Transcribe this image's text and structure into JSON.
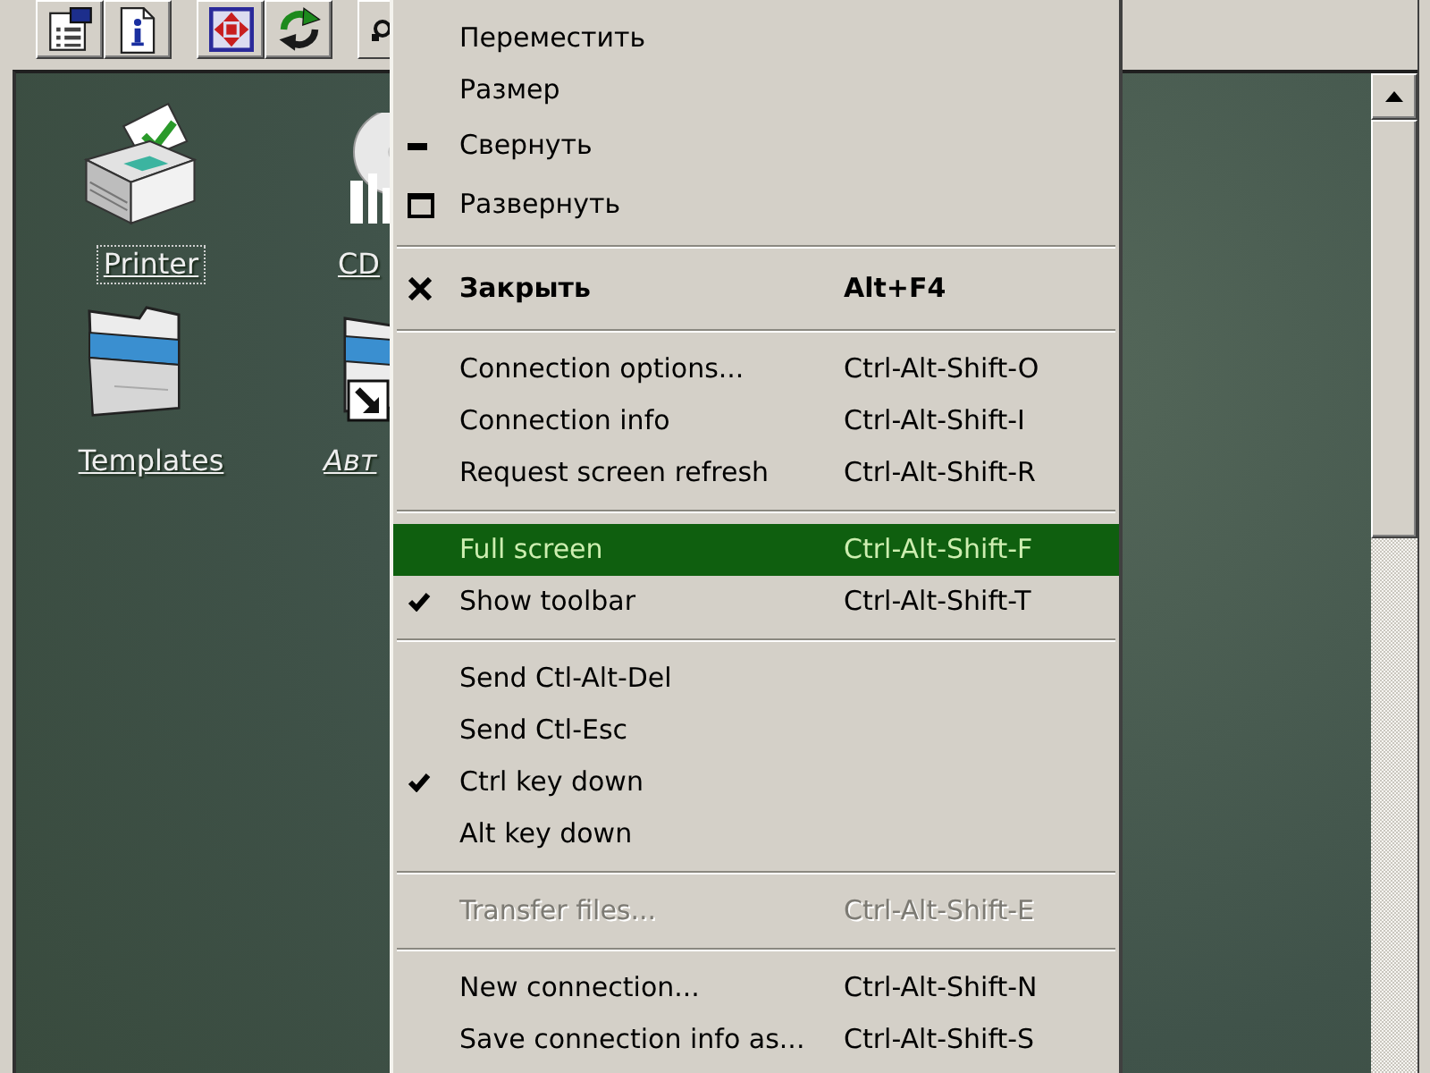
{
  "desktop_icons": [
    {
      "label": "Printer",
      "kind": "printer",
      "selected": true
    },
    {
      "label": "CD",
      "kind": "cd",
      "selected": false
    },
    {
      "label": "Templates",
      "kind": "folder",
      "selected": false
    },
    {
      "label": "Авт",
      "kind": "shortcut",
      "selected": false
    }
  ],
  "system_menu": {
    "items": [
      {
        "kind": "item",
        "label": "Переместить",
        "checked": false,
        "selected": false,
        "disabled": false,
        "default": false
      },
      {
        "kind": "item",
        "label": "Размер",
        "checked": false,
        "selected": false,
        "disabled": false,
        "default": false
      },
      {
        "kind": "minimize",
        "label": "Свернуть",
        "checked": false,
        "selected": false,
        "disabled": false,
        "default": false
      },
      {
        "kind": "maximize",
        "label": "Развернуть",
        "checked": false,
        "selected": false,
        "disabled": false,
        "default": false
      },
      {
        "kind": "separator"
      },
      {
        "kind": "close",
        "label": "Закрыть",
        "shortcut": "Alt+F4",
        "checked": false,
        "selected": false,
        "disabled": false,
        "default": true
      },
      {
        "kind": "separator"
      },
      {
        "kind": "item",
        "label": "Connection options...",
        "shortcut": "Ctrl-Alt-Shift-O",
        "checked": false,
        "selected": false,
        "disabled": false,
        "default": false
      },
      {
        "kind": "item",
        "label": "Connection info",
        "shortcut": "Ctrl-Alt-Shift-I",
        "checked": false,
        "selected": false,
        "disabled": false,
        "default": false
      },
      {
        "kind": "item",
        "label": "Request screen refresh",
        "shortcut": "Ctrl-Alt-Shift-R",
        "checked": false,
        "selected": false,
        "disabled": false,
        "default": false
      },
      {
        "kind": "separator"
      },
      {
        "kind": "item",
        "label": "Full screen",
        "shortcut": "Ctrl-Alt-Shift-F",
        "checked": false,
        "selected": true,
        "disabled": false,
        "default": false
      },
      {
        "kind": "item",
        "label": "Show toolbar",
        "shortcut": "Ctrl-Alt-Shift-T",
        "checked": true,
        "selected": false,
        "disabled": false,
        "default": false
      },
      {
        "kind": "separator"
      },
      {
        "kind": "item",
        "label": "Send Ctl-Alt-Del",
        "checked": false,
        "selected": false,
        "disabled": false,
        "default": false
      },
      {
        "kind": "item",
        "label": "Send Ctl-Esc",
        "checked": false,
        "selected": false,
        "disabled": false,
        "default": false
      },
      {
        "kind": "item",
        "label": "Ctrl key down",
        "checked": true,
        "selected": false,
        "disabled": false,
        "default": false
      },
      {
        "kind": "item",
        "label": "Alt key down",
        "checked": false,
        "selected": false,
        "disabled": false,
        "default": false
      },
      {
        "kind": "separator"
      },
      {
        "kind": "item",
        "label": "Transfer files...",
        "shortcut": "Ctrl-Alt-Shift-E",
        "checked": false,
        "selected": false,
        "disabled": true,
        "default": false
      },
      {
        "kind": "separator"
      },
      {
        "kind": "item",
        "label": "New connection...",
        "shortcut": "Ctrl-Alt-Shift-N",
        "checked": false,
        "selected": false,
        "disabled": false,
        "default": false
      },
      {
        "kind": "item",
        "label": "Save connection info as...",
        "shortcut": "Ctrl-Alt-Shift-S",
        "checked": false,
        "selected": false,
        "disabled": false,
        "default": false
      }
    ]
  }
}
